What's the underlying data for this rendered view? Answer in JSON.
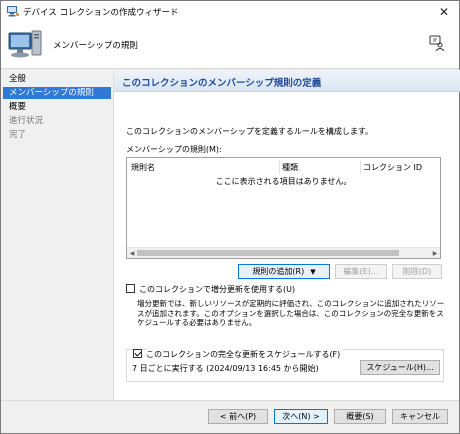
{
  "window": {
    "title": "デバイス コレクションの作成ウィザード",
    "close_glyph": "✕"
  },
  "header": {
    "title": "メンバーシップの規則"
  },
  "nav": {
    "items": [
      {
        "label": "全般",
        "state": "normal"
      },
      {
        "label": "メンバーシップの規則",
        "state": "selected"
      },
      {
        "label": "概要",
        "state": "normal"
      },
      {
        "label": "進行状況",
        "state": "disabled"
      },
      {
        "label": "完了",
        "state": "disabled"
      }
    ]
  },
  "main": {
    "banner_title": "このコレクションのメンバーシップ規則の定義",
    "description": "このコレクションのメンバーシップを定義するルールを構成します。",
    "rules_label": "メンバーシップの規則(M):",
    "columns": [
      "規則名",
      "種類",
      "コレクション ID"
    ],
    "empty_message": "ここに表示される項目はありません。",
    "add_rule_button": "規則の追加(R)",
    "edit_button": "編集(E)...",
    "delete_button": "削除(D)",
    "incremental_checkbox": {
      "label": "このコレクションで増分更新を使用する(U)",
      "checked": false
    },
    "incremental_note": "増分更新では、新しいリソースが定期的に評価され、このコレクションに追加されたリソースが追加されます。このオプションを選択した場合は、このコレクションの完全な更新をスケジュールする必要はありません。",
    "schedule_checkbox": {
      "label": "このコレクションの完全な更新をスケジュールする(F)",
      "checked": true
    },
    "schedule_text": "7 日ごとに実行する (2024/09/13 16:45 から開始)",
    "schedule_button": "スケジュール(H)..."
  },
  "footer": {
    "back_button": "< 前へ(P)",
    "next_button": "次へ(N) >",
    "summary_button": "概要(S)",
    "cancel_button": "キャンセル"
  },
  "colors": {
    "selected_nav": "#2f7ad6",
    "banner_text": "#1e4a9b"
  }
}
